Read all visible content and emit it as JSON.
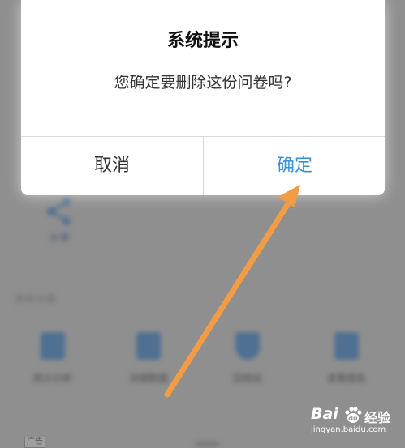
{
  "dialog": {
    "title": "系统提示",
    "message": "您确定要删除这份问卷吗?",
    "cancel_label": "取消",
    "confirm_label": "确定"
  },
  "background": {
    "share_label": "分享",
    "section_label": "其他功能",
    "tiles": [
      "统计分析",
      "详细数据",
      "回收站",
      "查看报告"
    ],
    "ad_badge": "广告"
  },
  "watermark": {
    "logo_text": "Bai",
    "brand_cn": "经验",
    "url": "jingyan.baidu.com"
  },
  "colors": {
    "confirm": "#3a8fd0",
    "arrow": "#f39c44",
    "overlay": "#8f8f8f"
  }
}
